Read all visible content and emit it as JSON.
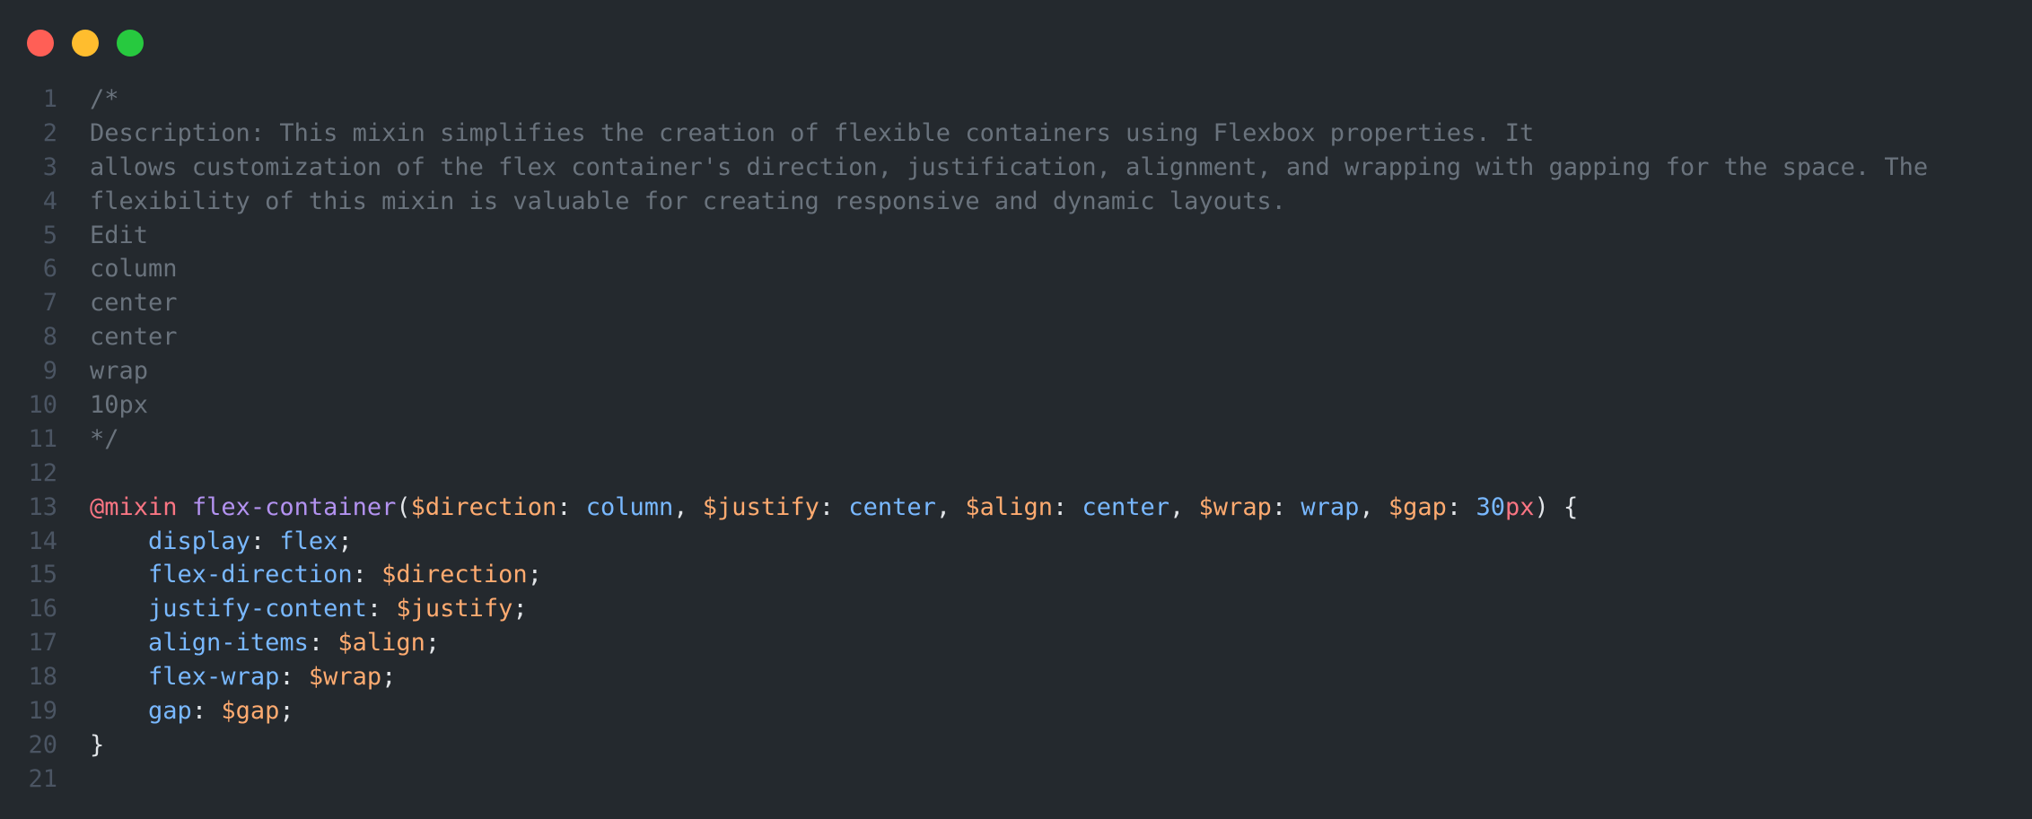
{
  "window": {
    "controls": {
      "close_color": "#ff5f56",
      "minimize_color": "#ffbd2e",
      "maximize_color": "#27c93f"
    }
  },
  "colors": {
    "background": "#24292e",
    "line_number": "#4b5563",
    "comment": "#6a737d",
    "keyword": "#f97583",
    "function": "#b392f0",
    "variable": "#ffab70",
    "property": "#79b8ff",
    "text": "#e1e4e8"
  },
  "code": {
    "lines": [
      {
        "n": "1",
        "tokens": [
          {
            "t": "/*",
            "k": "comment"
          }
        ]
      },
      {
        "n": "2",
        "tokens": [
          {
            "t": "Description: This mixin simplifies the creation of flexible containers using Flexbox properties. It",
            "k": "comment"
          }
        ]
      },
      {
        "n": "3",
        "tokens": [
          {
            "t": "allows customization of the flex container's direction, justification, alignment, and wrapping with gapping for the space. The",
            "k": "comment"
          }
        ]
      },
      {
        "n": "4",
        "tokens": [
          {
            "t": "flexibility of this mixin is valuable for creating responsive and dynamic layouts.",
            "k": "comment"
          }
        ]
      },
      {
        "n": "5",
        "tokens": [
          {
            "t": "Edit",
            "k": "comment"
          }
        ]
      },
      {
        "n": "6",
        "tokens": [
          {
            "t": "column",
            "k": "comment"
          }
        ]
      },
      {
        "n": "7",
        "tokens": [
          {
            "t": "center",
            "k": "comment"
          }
        ]
      },
      {
        "n": "8",
        "tokens": [
          {
            "t": "center",
            "k": "comment"
          }
        ]
      },
      {
        "n": "9",
        "tokens": [
          {
            "t": "wrap",
            "k": "comment"
          }
        ]
      },
      {
        "n": "10",
        "tokens": [
          {
            "t": "10px",
            "k": "comment"
          }
        ]
      },
      {
        "n": "11",
        "tokens": [
          {
            "t": "*/",
            "k": "comment"
          }
        ]
      },
      {
        "n": "12",
        "tokens": []
      },
      {
        "n": "13",
        "tokens": [
          {
            "t": "@mixin",
            "k": "keyword"
          },
          {
            "t": " ",
            "k": "punct"
          },
          {
            "t": "flex-container",
            "k": "fn"
          },
          {
            "t": "(",
            "k": "punct"
          },
          {
            "t": "$direction",
            "k": "var"
          },
          {
            "t": ": ",
            "k": "punct"
          },
          {
            "t": "column",
            "k": "value"
          },
          {
            "t": ", ",
            "k": "punct"
          },
          {
            "t": "$justify",
            "k": "var"
          },
          {
            "t": ": ",
            "k": "punct"
          },
          {
            "t": "center",
            "k": "value"
          },
          {
            "t": ", ",
            "k": "punct"
          },
          {
            "t": "$align",
            "k": "var"
          },
          {
            "t": ": ",
            "k": "punct"
          },
          {
            "t": "center",
            "k": "value"
          },
          {
            "t": ", ",
            "k": "punct"
          },
          {
            "t": "$wrap",
            "k": "var"
          },
          {
            "t": ": ",
            "k": "punct"
          },
          {
            "t": "wrap",
            "k": "value"
          },
          {
            "t": ", ",
            "k": "punct"
          },
          {
            "t": "$gap",
            "k": "var"
          },
          {
            "t": ": ",
            "k": "punct"
          },
          {
            "t": "30",
            "k": "num"
          },
          {
            "t": "px",
            "k": "unit"
          },
          {
            "t": ") {",
            "k": "punct"
          }
        ]
      },
      {
        "n": "14",
        "tokens": [
          {
            "t": "    ",
            "k": "punct"
          },
          {
            "t": "display",
            "k": "prop"
          },
          {
            "t": ": ",
            "k": "punct"
          },
          {
            "t": "flex",
            "k": "value"
          },
          {
            "t": ";",
            "k": "punct"
          }
        ]
      },
      {
        "n": "15",
        "tokens": [
          {
            "t": "    ",
            "k": "punct"
          },
          {
            "t": "flex-direction",
            "k": "prop"
          },
          {
            "t": ": ",
            "k": "punct"
          },
          {
            "t": "$direction",
            "k": "var"
          },
          {
            "t": ";",
            "k": "punct"
          }
        ]
      },
      {
        "n": "16",
        "tokens": [
          {
            "t": "    ",
            "k": "punct"
          },
          {
            "t": "justify-content",
            "k": "prop"
          },
          {
            "t": ": ",
            "k": "punct"
          },
          {
            "t": "$justify",
            "k": "var"
          },
          {
            "t": ";",
            "k": "punct"
          }
        ]
      },
      {
        "n": "17",
        "tokens": [
          {
            "t": "    ",
            "k": "punct"
          },
          {
            "t": "align-items",
            "k": "prop"
          },
          {
            "t": ": ",
            "k": "punct"
          },
          {
            "t": "$align",
            "k": "var"
          },
          {
            "t": ";",
            "k": "punct"
          }
        ]
      },
      {
        "n": "18",
        "tokens": [
          {
            "t": "    ",
            "k": "punct"
          },
          {
            "t": "flex-wrap",
            "k": "prop"
          },
          {
            "t": ": ",
            "k": "punct"
          },
          {
            "t": "$wrap",
            "k": "var"
          },
          {
            "t": ";",
            "k": "punct"
          }
        ]
      },
      {
        "n": "19",
        "tokens": [
          {
            "t": "    ",
            "k": "punct"
          },
          {
            "t": "gap",
            "k": "prop"
          },
          {
            "t": ": ",
            "k": "punct"
          },
          {
            "t": "$gap",
            "k": "var"
          },
          {
            "t": ";",
            "k": "punct"
          }
        ]
      },
      {
        "n": "20",
        "tokens": [
          {
            "t": "}",
            "k": "punct"
          }
        ]
      },
      {
        "n": "21",
        "tokens": []
      }
    ]
  }
}
